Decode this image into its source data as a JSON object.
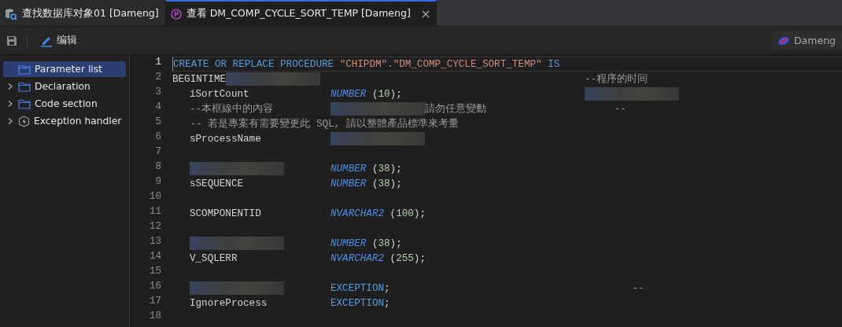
{
  "tabs": [
    {
      "label": "查找数据库对象01 [Dameng]",
      "kind": "search",
      "selected": false,
      "closable": false
    },
    {
      "label": "查看 DM_COMP_CYCLE_SORT_TEMP [Dameng]",
      "kind": "procedure",
      "selected": true,
      "closable": true
    }
  ],
  "toolbar": {
    "edit_label": "编辑",
    "connection": "Dameng"
  },
  "sidebar": {
    "items": [
      {
        "label": "Parameter list",
        "kind": "folder",
        "selected": true,
        "expandable": false
      },
      {
        "label": "Declaration",
        "kind": "folder",
        "selected": false,
        "expandable": true
      },
      {
        "label": "Code section",
        "kind": "folder",
        "selected": false,
        "expandable": true
      },
      {
        "label": "Exception handler",
        "kind": "handler",
        "selected": false,
        "expandable": true
      }
    ]
  },
  "editor": {
    "lines": [
      {
        "n": "1",
        "current": true,
        "code": [
          {
            "kind": "keyword",
            "text": "CREATE OR REPLACE PROCEDURE "
          },
          {
            "kind": "string",
            "text": "\"CHIPDM\".\"DM_COMP_CYCLE_SORT_TEMP\""
          },
          {
            "kind": "keyword",
            "text": " IS"
          }
        ]
      },
      {
        "n": "2",
        "code": [
          {
            "kind": "plain",
            "text": "BEGINTIME"
          },
          {
            "kind": "redacted"
          }
        ],
        "note": [
          {
            "kind": "comment",
            "text": "--程序的时间"
          }
        ]
      },
      {
        "n": "3",
        "name": [
          {
            "kind": "plain",
            "text": "iSortCount"
          }
        ],
        "decl": [
          {
            "kind": "type",
            "text": "NUMBER"
          },
          {
            "kind": "punct",
            "text": " ("
          },
          {
            "kind": "number",
            "text": "10"
          },
          {
            "kind": "punct",
            "text": ");"
          }
        ],
        "note": [
          {
            "kind": "redacted"
          }
        ]
      },
      {
        "n": "4",
        "name": [
          {
            "kind": "comment",
            "text": "--本框線中的內容"
          }
        ],
        "decl": [
          {
            "kind": "redacted"
          },
          {
            "kind": "comment",
            "text": "請勿任意變動"
          }
        ],
        "note": [
          {
            "kind": "comment",
            "text": "     --"
          }
        ]
      },
      {
        "n": "5",
        "code": [
          {
            "kind": "comment",
            "text": "   -- 若是專案有需要變更此 SQL, 請以整體產品標準來考量"
          }
        ]
      },
      {
        "n": "6",
        "name": [
          {
            "kind": "plain",
            "text": "sProcessName"
          }
        ],
        "decl": [
          {
            "kind": "redacted"
          }
        ]
      },
      {
        "n": "7"
      },
      {
        "n": "8",
        "name": [
          {
            "kind": "redacted"
          }
        ],
        "decl": [
          {
            "kind": "type",
            "text": "NUMBER"
          },
          {
            "kind": "punct",
            "text": " ("
          },
          {
            "kind": "number",
            "text": "38"
          },
          {
            "kind": "punct",
            "text": ");"
          }
        ]
      },
      {
        "n": "9",
        "name": [
          {
            "kind": "plain",
            "text": "sSEQUENCE"
          }
        ],
        "decl": [
          {
            "kind": "type",
            "text": "NUMBER"
          },
          {
            "kind": "punct",
            "text": " ("
          },
          {
            "kind": "number",
            "text": "38"
          },
          {
            "kind": "punct",
            "text": ");"
          }
        ]
      },
      {
        "n": "10"
      },
      {
        "n": "11",
        "name": [
          {
            "kind": "plain",
            "text": "SCOMPONENTID"
          }
        ],
        "decl": [
          {
            "kind": "type",
            "text": "NVARCHAR2"
          },
          {
            "kind": "punct",
            "text": " ("
          },
          {
            "kind": "number",
            "text": "100"
          },
          {
            "kind": "punct",
            "text": ");"
          }
        ]
      },
      {
        "n": "12"
      },
      {
        "n": "13",
        "name": [
          {
            "kind": "redacted"
          }
        ],
        "decl": [
          {
            "kind": "type",
            "text": "NUMBER"
          },
          {
            "kind": "punct",
            "text": " ("
          },
          {
            "kind": "number",
            "text": "38"
          },
          {
            "kind": "punct",
            "text": ");"
          }
        ]
      },
      {
        "n": "14",
        "name": [
          {
            "kind": "plain",
            "text": "V_SQLERR"
          }
        ],
        "decl": [
          {
            "kind": "type",
            "text": "NVARCHAR2"
          },
          {
            "kind": "punct",
            "text": " ("
          },
          {
            "kind": "number",
            "text": "255"
          },
          {
            "kind": "punct",
            "text": ");"
          }
        ]
      },
      {
        "n": "15"
      },
      {
        "n": "16",
        "name": [
          {
            "kind": "redacted"
          }
        ],
        "decl": [
          {
            "kind": "keyword",
            "text": "EXCEPTION"
          },
          {
            "kind": "punct",
            "text": ";"
          }
        ],
        "note": [
          {
            "kind": "comment",
            "text": "        --"
          }
        ]
      },
      {
        "n": "17",
        "name": [
          {
            "kind": "plain",
            "text": "IgnoreProcess"
          }
        ],
        "decl": [
          {
            "kind": "keyword",
            "text": "EXCEPTION"
          },
          {
            "kind": "punct",
            "text": ";"
          }
        ]
      },
      {
        "n": "18"
      }
    ]
  }
}
